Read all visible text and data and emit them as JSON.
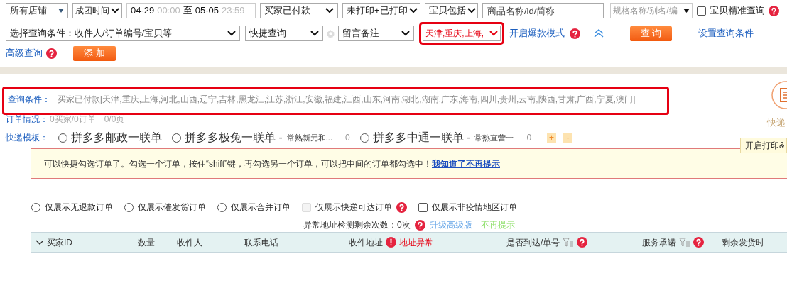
{
  "row1": {
    "shop_select": "所有店铺",
    "time_type_select": "成团时间",
    "date_range": {
      "start_date": "04-29",
      "start_time": "00:00",
      "separator": "至",
      "end_date": "05-05",
      "end_time": "23:59"
    },
    "pay_status_select": "买家已付款",
    "print_status_select": "未打印+已打印",
    "item_filter_select": "宝贝包括",
    "item_field": {
      "placeholder": "商品名称/id/简称"
    },
    "spec_select": "规格名称/别名/编",
    "exact_match": {
      "label": "宝贝精准查询",
      "checked": false
    }
  },
  "row2": {
    "condition_select": "选择查询条件：收件人/订单编号/宝贝等",
    "quick_query_select": "快捷查询",
    "remark_select": "留言备注",
    "region_select": {
      "value": "天津,重庆,上海,",
      "annotated": true
    },
    "hot_mode_link": "开启爆款模式",
    "query_button": "查 询",
    "settings_link": "设置查询条件"
  },
  "row3": {
    "advanced_link": "高级查询",
    "add_button": "添 加"
  },
  "summary": {
    "annotated": true,
    "query_label": "查询条件：",
    "query_text": "买家已付款[天津,重庆,上海,河北,山西,辽宁,吉林,黑龙江,江苏,浙江,安徽,福建,江西,山东,河南,湖北,湖南,广东,海南,四川,贵州,云南,陕西,甘肃,广西,宁夏,澳门]",
    "order_label": "订单情况：",
    "order_text": "0买家/0订单",
    "page_text": "0/0页"
  },
  "side": {
    "shortcut_label": "快递",
    "tooltip": "开启打印&"
  },
  "express": {
    "label": "快递模板：",
    "templates": [
      {
        "name": "拼多多邮政一联单",
        "selected": false
      },
      {
        "name": "拼多多极兔一联单 -",
        "note": "常熟新元和...",
        "count": "0",
        "selected": false
      },
      {
        "name": "拼多多中通一联单 -",
        "note": "常熟直营一",
        "count": "0",
        "selected": false
      }
    ],
    "add": "+",
    "remove": "-"
  },
  "notice": {
    "text": "可以快捷勾选订单了。勾选一个订单，按住“shift”键，再勾选另一个订单，可以把中间的订单都勾选中！",
    "link": "我知道了不再提示"
  },
  "filters": [
    {
      "kind": "radio",
      "label": "仅展示无退款订单",
      "selected": false
    },
    {
      "kind": "radio",
      "label": "仅展示催发货订单",
      "selected": false
    },
    {
      "kind": "radio",
      "label": "仅展示合并订单",
      "selected": false
    },
    {
      "kind": "checkbox",
      "label": "仅展示快递可达订单",
      "checked": false,
      "disabled": true,
      "help": true
    },
    {
      "kind": "checkbox",
      "label": "仅展示非疫情地区订单",
      "checked": false,
      "disabled": false
    }
  ],
  "address_check": {
    "text": "异常地址检测剩余次数：0次",
    "upgrade_link": "升级高级版",
    "dismiss_link": "不再提示"
  },
  "table": {
    "columns": [
      {
        "label": "买家ID",
        "expander": true
      },
      {
        "label": "数量"
      },
      {
        "label": "收件人"
      },
      {
        "label": "联系电话"
      },
      {
        "label": "收件地址",
        "warning": "地址异常"
      },
      {
        "label": "是否到达/单号",
        "filter": true,
        "help": true
      },
      {
        "label": "服务承诺",
        "filter": true,
        "help": true
      },
      {
        "label": "剩余发货时"
      }
    ]
  }
}
